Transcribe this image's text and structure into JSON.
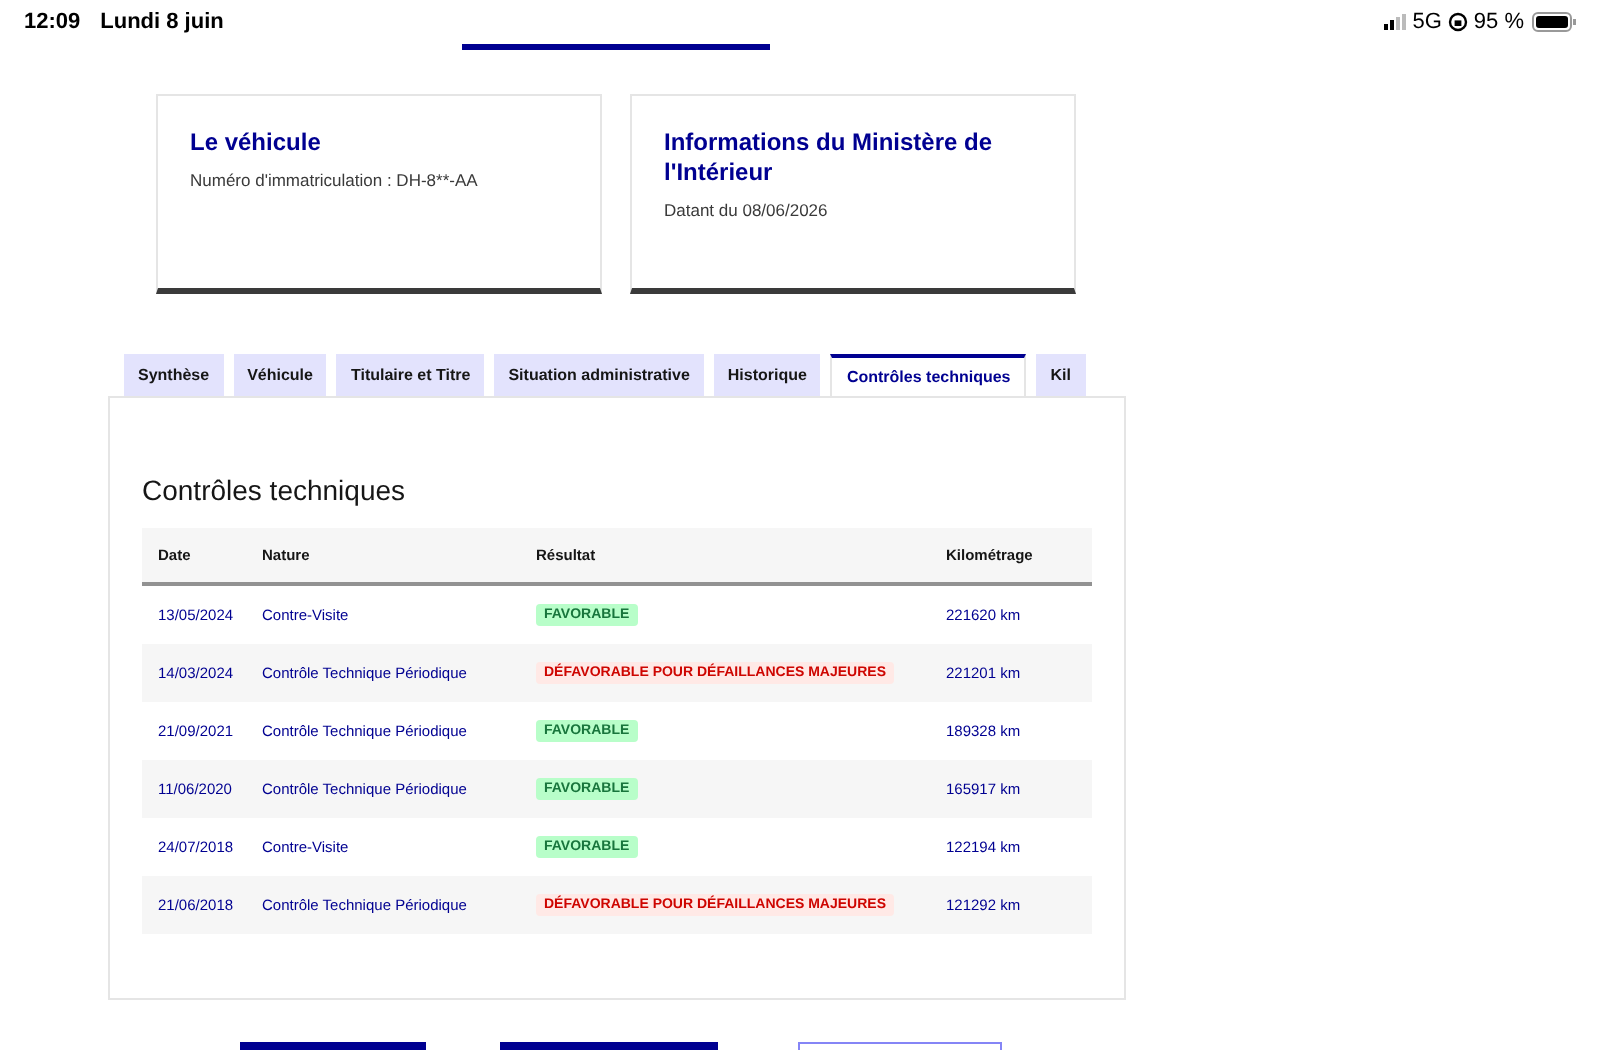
{
  "status_bar": {
    "time": "12:09",
    "date": "Lundi 8 juin",
    "network": "5G",
    "battery": "95 %"
  },
  "cards": [
    {
      "title": "Le véhicule",
      "subtitle": "Numéro d'immatriculation : DH-8**-AA"
    },
    {
      "title": "Informations du Ministère de l'Intérieur",
      "subtitle": "Datant du 08/06/2026"
    }
  ],
  "tabs": [
    {
      "label": "Synthèse",
      "selected": false
    },
    {
      "label": "Véhicule",
      "selected": false
    },
    {
      "label": "Titulaire et Titre",
      "selected": false
    },
    {
      "label": "Situation administrative",
      "selected": false
    },
    {
      "label": "Historique",
      "selected": false
    },
    {
      "label": "Contrôles techniques",
      "selected": true
    },
    {
      "label": "Kil",
      "selected": false
    }
  ],
  "panel": {
    "title": "Contrôles techniques",
    "table": {
      "columns": [
        "Date",
        "Nature",
        "Résultat",
        "Kilométrage"
      ],
      "rows": [
        {
          "date": "13/05/2024",
          "nature": "Contre-Visite",
          "result": {
            "label": "FAVORABLE",
            "kind": "favorable"
          },
          "mileage": "221620 km"
        },
        {
          "date": "14/03/2024",
          "nature": "Contrôle Technique Périodique",
          "result": {
            "label": "DÉFAVORABLE POUR DÉFAILLANCES MAJEURES",
            "kind": "unfavorable"
          },
          "mileage": "221201 km"
        },
        {
          "date": "21/09/2021",
          "nature": "Contrôle Technique Périodique",
          "result": {
            "label": "FAVORABLE",
            "kind": "favorable"
          },
          "mileage": "189328 km"
        },
        {
          "date": "11/06/2020",
          "nature": "Contrôle Technique Périodique",
          "result": {
            "label": "FAVORABLE",
            "kind": "favorable"
          },
          "mileage": "165917 km"
        },
        {
          "date": "24/07/2018",
          "nature": "Contre-Visite",
          "result": {
            "label": "FAVORABLE",
            "kind": "favorable"
          },
          "mileage": "122194 km"
        },
        {
          "date": "21/06/2018",
          "nature": "Contrôle Technique Périodique",
          "result": {
            "label": "DÉFAVORABLE POUR DÉFAILLANCES MAJEURES",
            "kind": "unfavorable"
          },
          "mileage": "121292 km"
        }
      ]
    }
  }
}
